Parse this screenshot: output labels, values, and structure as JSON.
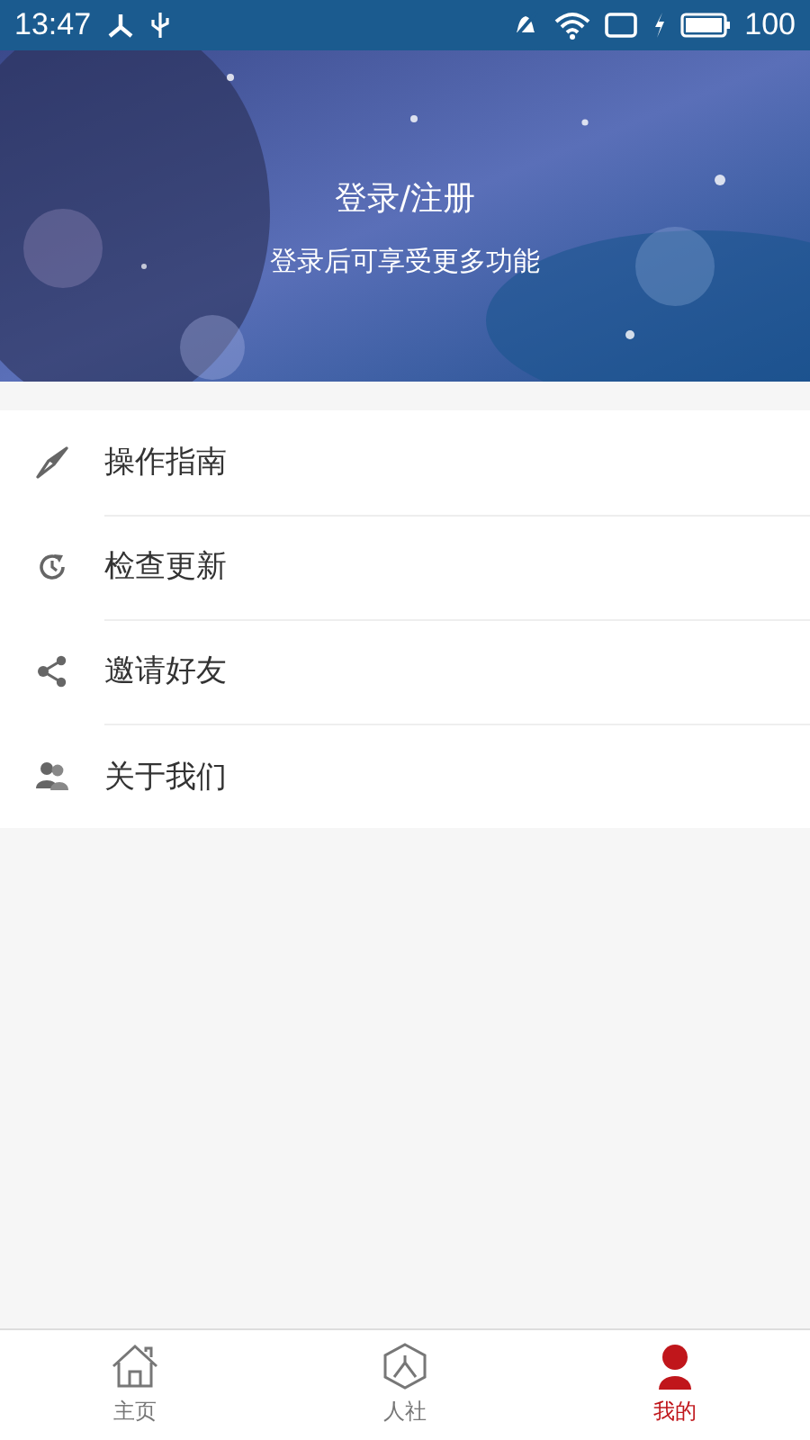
{
  "status_bar": {
    "time": "13:47",
    "battery": "100"
  },
  "header": {
    "kind": "picture",
    "login": "登录/注册",
    "subtitle": "登录后可享受更多功能"
  },
  "menu": [
    {
      "kind": "guide",
      "label": "操作指南"
    },
    {
      "kind": "update",
      "label": "检查更新"
    },
    {
      "kind": "share",
      "label": "邀请好友"
    },
    {
      "kind": "about",
      "label": "关于我们"
    }
  ],
  "tabs": [
    {
      "kind": "home",
      "label": "主页",
      "selected": false
    },
    {
      "kind": "social",
      "label": "人社",
      "selected": false
    },
    {
      "kind": "me",
      "label": "我的",
      "selected": true
    }
  ]
}
